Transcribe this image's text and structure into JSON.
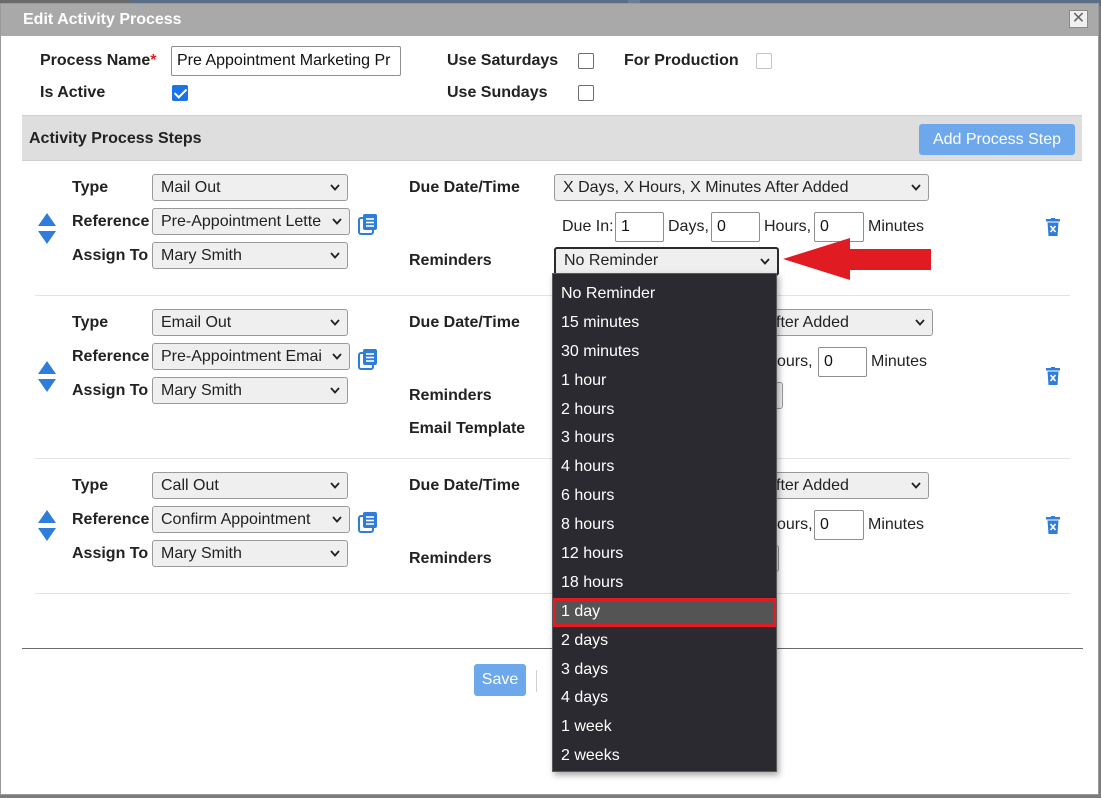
{
  "dialog": {
    "title": "Edit Activity Process",
    "close_glyph": "✕"
  },
  "form": {
    "process_name_label": "Process Name",
    "required_mark": "*",
    "process_name_value": "Pre Appointment Marketing Pr",
    "is_active_label": "Is Active",
    "is_active_checked": true,
    "use_saturdays_label": "Use Saturdays",
    "use_sundays_label": "Use Sundays",
    "for_production_label": "For Production"
  },
  "steps_section": {
    "title": "Activity Process Steps",
    "add_button": "Add Process Step"
  },
  "steps": [
    {
      "type_label": "Type",
      "type_value": "Mail Out",
      "reference_label": "Reference",
      "reference_value": "Pre-Appointment Lette",
      "assign_label": "Assign To",
      "assign_value": "Mary Smith",
      "due_label": "Due Date/Time",
      "due_value": "X Days, X Hours, X Minutes After Added",
      "due_in_label": "Due In:",
      "days_value": "1",
      "days_label": "Days,",
      "hours_value": "0",
      "hours_label": "Hours,",
      "minutes_value": "0",
      "minutes_label": "Minutes",
      "reminders_label": "Reminders",
      "reminders_value": "No Reminder"
    },
    {
      "type_label": "Type",
      "type_value": "Email Out",
      "reference_label": "Reference",
      "reference_value": "Pre-Appointment Emai",
      "assign_label": "Assign To",
      "assign_value": "Mary Smith",
      "due_label": "Due Date/Time",
      "due_value_visible": "fter Added",
      "hours_label_partial": "ours,",
      "minutes_value": "0",
      "minutes_label": "Minutes",
      "reminders_label": "Reminders",
      "email_template_label": "Email Template"
    },
    {
      "type_label": "Type",
      "type_value": "Call Out",
      "reference_label": "Reference",
      "reference_value": "Confirm Appointment",
      "assign_label": "Assign To",
      "assign_value": "Mary Smith",
      "due_label": "Due Date/Time",
      "due_value_visible": "fter Added",
      "hours_label_partial": "ours,",
      "minutes_value": "0",
      "minutes_label": "Minutes",
      "reminders_label": "Reminders"
    }
  ],
  "footer": {
    "save_label": "Save"
  },
  "reminder_options": [
    "No Reminder",
    "15 minutes",
    "30 minutes",
    "1 hour",
    "2 hours",
    "3 hours",
    "4 hours",
    "6 hours",
    "8 hours",
    "12 hours",
    "18 hours",
    "1 day",
    "2 days",
    "3 days",
    "4 days",
    "1 week",
    "2 weeks"
  ],
  "highlighted_option": "1 day",
  "icons": {
    "reorder": "up-down-arrows-icon",
    "reference_detail": "document-list-icon",
    "delete": "trash-icon",
    "dropdown": "chevron-down-icon",
    "annotation": "red-arrow-icon"
  },
  "colors": {
    "accent_blue": "#1a73e8",
    "button_blue": "#6ea8ec",
    "annotation_red": "#e01b22",
    "dropdown_bg": "#2b2a30"
  }
}
